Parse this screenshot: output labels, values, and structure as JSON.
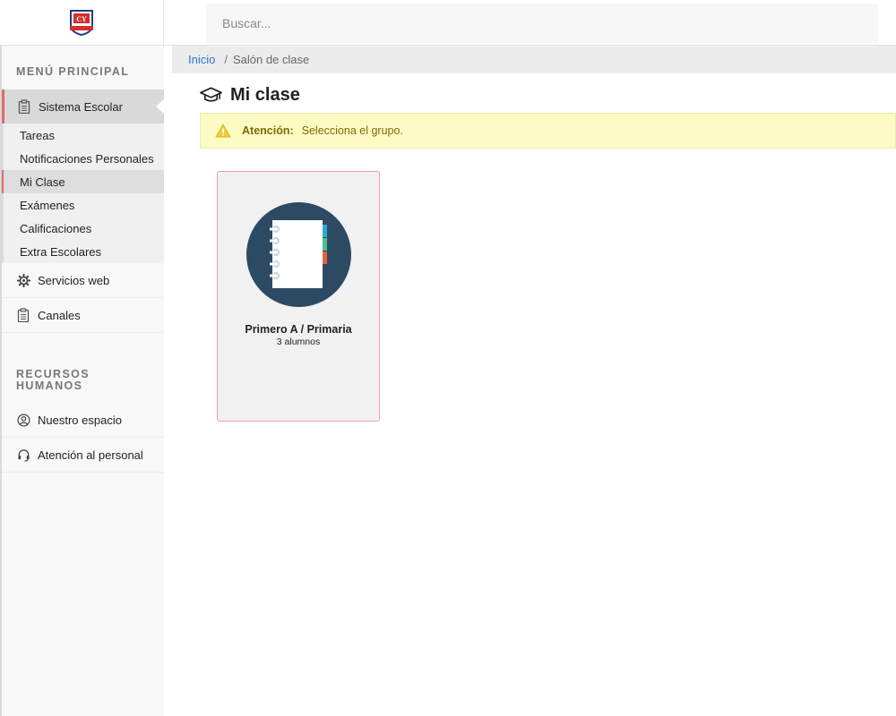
{
  "header": {
    "logo_alt": "CY",
    "search_placeholder": "Buscar..."
  },
  "sidebar": {
    "main_section_title": "MENÚ PRINCIPAL",
    "active_menu": {
      "label": "Sistema Escolar",
      "icon": "clipboard-icon"
    },
    "submenu": [
      {
        "label": "Tareas",
        "selected": false
      },
      {
        "label": "Notificaciones Personales",
        "selected": false
      },
      {
        "label": "Mi Clase",
        "selected": true
      },
      {
        "label": "Exámenes",
        "selected": false
      },
      {
        "label": "Calificaciones",
        "selected": false
      },
      {
        "label": "Extra Escolares",
        "selected": false
      }
    ],
    "items": [
      {
        "label": "Servicios web",
        "icon": "gear-icon"
      },
      {
        "label": "Canales",
        "icon": "clipboard-icon"
      }
    ],
    "hr_section_title": "RECURSOS HUMANOS",
    "hr_items": [
      {
        "label": "Nuestro espacio",
        "icon": "user-circle-icon"
      },
      {
        "label": "Atención al personal",
        "icon": "headset-icon"
      }
    ]
  },
  "breadcrumb": {
    "home": "Inicio",
    "separator": "/",
    "current": "Salón de clase"
  },
  "page": {
    "title": "Mi clase",
    "title_icon": "graduation-cap-icon"
  },
  "alert": {
    "label": "Atención:",
    "message": "Selecciona el grupo.",
    "icon": "warning-icon"
  },
  "groups": [
    {
      "name": "Primero A / Primaria",
      "students": "3 alumnos",
      "icon": "notebook-icon"
    }
  ],
  "colors": {
    "accent": "#e26a6a",
    "link": "#2a7ac8",
    "alert_bg": "#fdfbc4",
    "icon_circle": "#2d4a63"
  }
}
